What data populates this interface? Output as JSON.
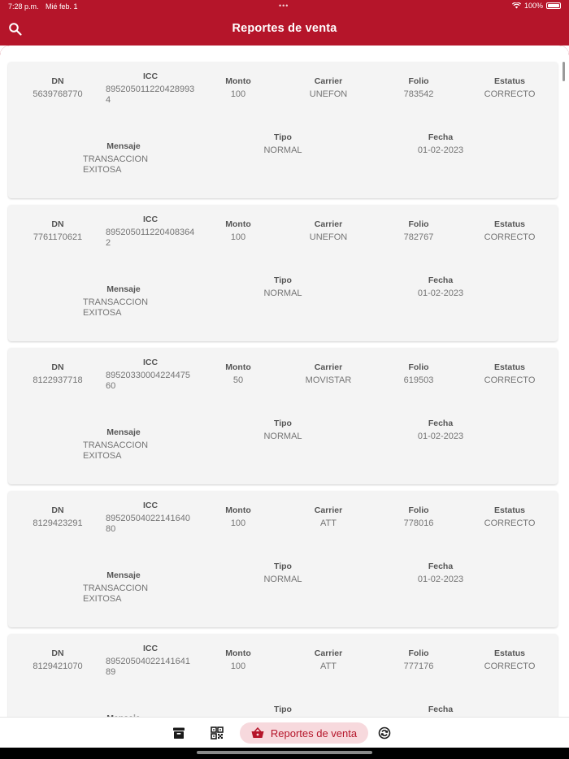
{
  "status_bar": {
    "time": "7:28 p.m.",
    "date": "Mié feb. 1",
    "battery": "100%"
  },
  "app_bar": {
    "title": "Reportes de venta"
  },
  "labels": {
    "dn": "DN",
    "icc": "ICC",
    "monto": "Monto",
    "carrier": "Carrier",
    "folio": "Folio",
    "estatus": "Estatus",
    "mensaje": "Mensaje",
    "tipo": "Tipo",
    "fecha": "Fecha"
  },
  "reports": [
    {
      "dn": "5639768770",
      "icc": "8952050112204289934",
      "monto": "100",
      "carrier": "UNEFON",
      "folio": "783542",
      "estatus": "CORRECTO",
      "mensaje": "TRANSACCION EXITOSA",
      "tipo": "NORMAL",
      "fecha": "01-02-2023"
    },
    {
      "dn": "7761170621",
      "icc": "8952050112204083642",
      "monto": "100",
      "carrier": "UNEFON",
      "folio": "782767",
      "estatus": "CORRECTO",
      "mensaje": "TRANSACCION EXITOSA",
      "tipo": "NORMAL",
      "fecha": "01-02-2023"
    },
    {
      "dn": "8122937718",
      "icc": "8952033000422447560",
      "monto": "50",
      "carrier": "MOVISTAR",
      "folio": "619503",
      "estatus": "CORRECTO",
      "mensaje": "TRANSACCION EXITOSA",
      "tipo": "NORMAL",
      "fecha": "01-02-2023"
    },
    {
      "dn": "8129423291",
      "icc": "8952050402214164080",
      "monto": "100",
      "carrier": "ATT",
      "folio": "778016",
      "estatus": "CORRECTO",
      "mensaje": "TRANSACCION EXITOSA",
      "tipo": "NORMAL",
      "fecha": "01-02-2023"
    },
    {
      "dn": "8129421070",
      "icc": "8952050402214164189",
      "monto": "100",
      "carrier": "ATT",
      "folio": "777176",
      "estatus": "CORRECTO",
      "mensaje": "",
      "tipo": "",
      "fecha": ""
    }
  ],
  "bottom_nav": {
    "items": [
      {
        "icon": "archive-icon"
      },
      {
        "icon": "qr-code-icon"
      },
      {
        "icon": "basket-icon",
        "label": "Reportes de venta",
        "active": true
      },
      {
        "icon": "sync-icon"
      }
    ]
  },
  "colors": {
    "primary": "#b5152a",
    "active_pill": "#f7d9dd",
    "card": "#f4f4f4"
  }
}
